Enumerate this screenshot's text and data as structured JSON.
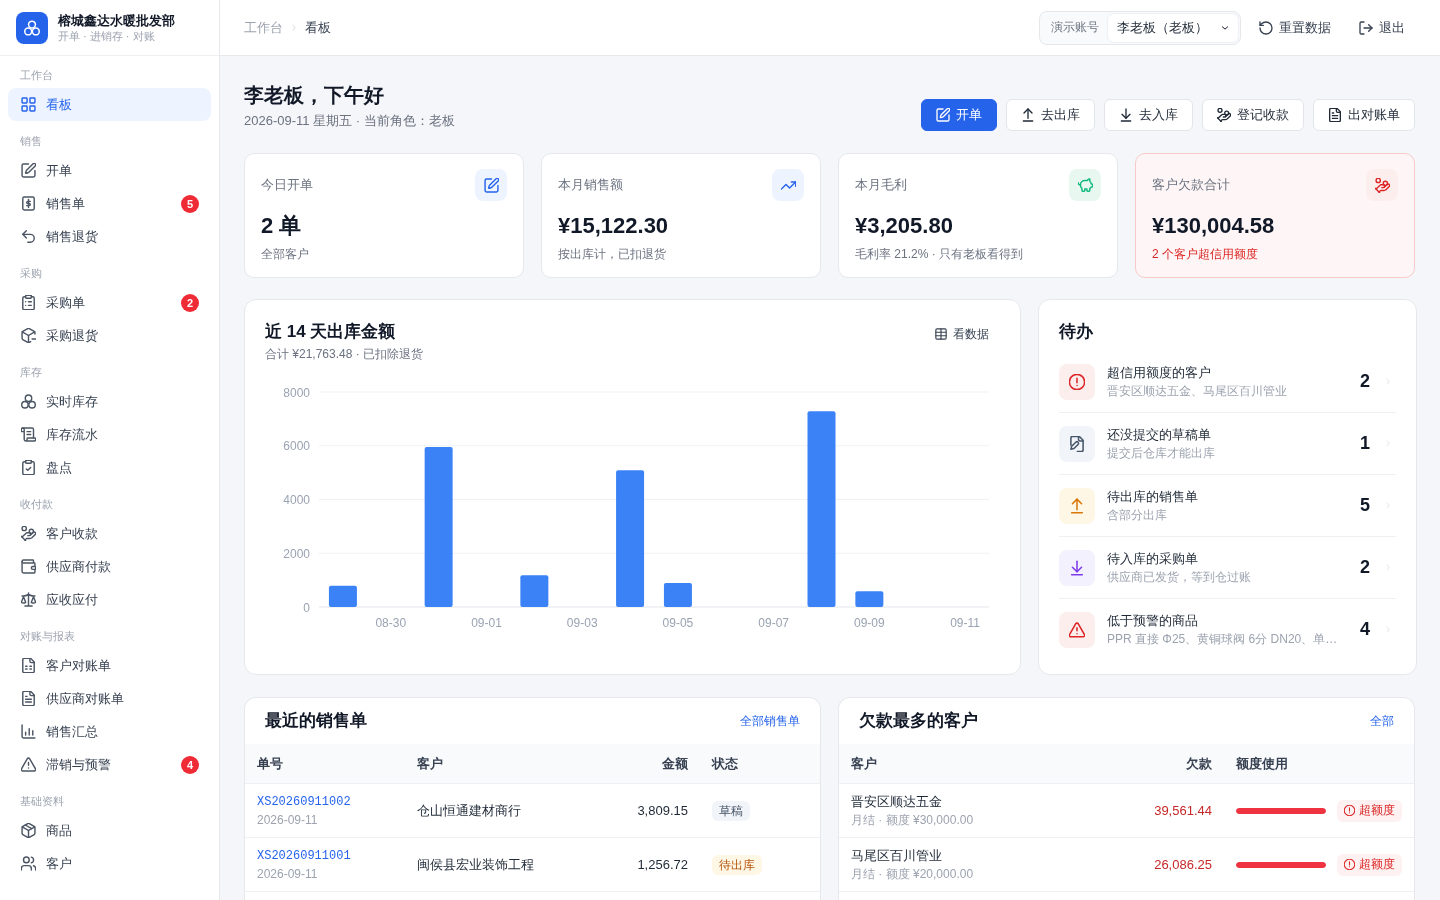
{
  "sidebar": {
    "brand": {
      "name": "榕城鑫达水暖批发部",
      "tagline": "开单 · 进销存 · 对账"
    },
    "sections": [
      {
        "label": "工作台",
        "items": [
          {
            "label": "看板",
            "selected": true
          }
        ]
      },
      {
        "label": "销售",
        "items": [
          {
            "label": "开单",
            "selected": false
          },
          {
            "label": "销售单",
            "selected": false,
            "badge": "5"
          },
          {
            "label": "销售退货",
            "selected": false
          }
        ]
      },
      {
        "label": "采购",
        "items": [
          {
            "label": "采购单",
            "selected": false,
            "badge": "2"
          },
          {
            "label": "采购退货",
            "selected": false
          }
        ]
      },
      {
        "label": "库存",
        "items": [
          {
            "label": "实时库存",
            "selected": false
          },
          {
            "label": "库存流水",
            "selected": false
          },
          {
            "label": "盘点",
            "selected": false
          }
        ]
      },
      {
        "label": "收付款",
        "items": [
          {
            "label": "客户收款",
            "selected": false
          },
          {
            "label": "供应商付款",
            "selected": false
          },
          {
            "label": "应收应付",
            "selected": false
          }
        ]
      },
      {
        "label": "对账与报表",
        "items": [
          {
            "label": "客户对账单",
            "selected": false
          },
          {
            "label": "供应商对账单",
            "selected": false
          },
          {
            "label": "销售汇总",
            "selected": false
          },
          {
            "label": "滞销与预警",
            "selected": false,
            "badge": "4"
          }
        ]
      },
      {
        "label": "基础资料",
        "items": [
          {
            "label": "商品",
            "selected": false
          },
          {
            "label": "客户",
            "selected": false
          }
        ]
      }
    ]
  },
  "header": {
    "breadcrumb": [
      "工作台",
      "看板"
    ],
    "account": {
      "label": "演示账号",
      "value": "李老板（老板）"
    },
    "actions": [
      "重置数据",
      "退出"
    ]
  },
  "greeting": {
    "title": "李老板，下午好",
    "subtitle": "2026-09-11 星期五 · 当前角色：老板"
  },
  "quick_actions": [
    {
      "label": "开单",
      "primary": true
    },
    {
      "label": "去出库",
      "primary": false
    },
    {
      "label": "去入库",
      "primary": false
    },
    {
      "label": "登记收款",
      "primary": false
    },
    {
      "label": "出对账单",
      "primary": false
    }
  ],
  "stats": [
    {
      "kind": "orders",
      "label": "今日开单",
      "value": "2 单",
      "note": "全部客户",
      "warning": false
    },
    {
      "kind": "sales",
      "label": "本月销售额",
      "value": "¥15,122.30",
      "note": "按出库计，已扣退货",
      "warning": false
    },
    {
      "kind": "profit",
      "label": "本月毛利",
      "value": "¥3,205.80",
      "note": "毛利率 21.2% · 只有老板看得到",
      "warning": false
    },
    {
      "kind": "debt",
      "label": "客户欠款合计",
      "value": "¥130,004.58",
      "note": "2 个客户超信用额度",
      "warning": true
    }
  ],
  "sales_chart": {
    "subtitle": "合计 ¥21,763.48 · 已扣除退货",
    "action": "看数据",
    "chart_data": {
      "type": "bar",
      "title": "近 14 天出库金额",
      "categories": [
        null,
        "08-30",
        null,
        "09-01",
        null,
        "09-03",
        null,
        "09-05",
        null,
        "09-07",
        null,
        "09-09",
        null,
        "09-11"
      ],
      "values": [
        790,
        0,
        5950,
        0,
        1180,
        0,
        5090,
        890,
        0,
        0,
        7280,
        590,
        0,
        0
      ],
      "yticks": [
        0,
        2000,
        4000,
        6000,
        8000
      ],
      "ylim": [
        0,
        8000
      ],
      "grid": true
    }
  },
  "todo": {
    "title": "待办",
    "items": [
      {
        "kind": "over_credit",
        "title": "超信用额度的客户",
        "detail": "晋安区顺达五金、马尾区百川管业",
        "count": "2"
      },
      {
        "kind": "draft",
        "title": "还没提交的草稿单",
        "detail": "提交后仓库才能出库",
        "count": "1"
      },
      {
        "kind": "to_ship",
        "title": "待出库的销售单",
        "detail": "含部分出库",
        "count": "5"
      },
      {
        "kind": "to_receive",
        "title": "待入库的采购单",
        "detail": "供应商已发货，等到仓过账",
        "count": "2"
      },
      {
        "kind": "low_stock",
        "title": "低于预警的商品",
        "detail": "PPR 直接 Φ25、黄铜球阀 6分 DN20、单…",
        "count": "4"
      }
    ]
  },
  "recent_sales": {
    "title": "最近的销售单",
    "link": "全部销售单",
    "columns": [
      "单号",
      "客户",
      "金额",
      "状态"
    ],
    "rows": [
      {
        "number": "XS20260911002",
        "date": "2026-09-11",
        "customer": "仓山恒通建材商行",
        "amount": "3,809.15",
        "status": {
          "label": "草稿",
          "kind": "draft"
        }
      },
      {
        "number": "XS20260911001",
        "date": "2026-09-11",
        "customer": "闽侯县宏业装饰工程",
        "amount": "1,256.72",
        "status": {
          "label": "待出库",
          "kind": "pending"
        }
      }
    ]
  },
  "top_debtors": {
    "title": "欠款最多的客户",
    "link": "全部",
    "columns": [
      "客户",
      "欠款",
      "额度使用"
    ],
    "rows": [
      {
        "name": "晋安区顺达五金",
        "terms": "月结 · 额度 ¥30,000.00",
        "debt": "39,561.44",
        "level": 1,
        "over_limit": true,
        "badge": "超额度"
      },
      {
        "name": "马尾区百川管业",
        "terms": "月结 · 额度 ¥20,000.00",
        "debt": "26,086.25",
        "level": 1,
        "over_limit": true,
        "badge": "超额度"
      }
    ]
  }
}
